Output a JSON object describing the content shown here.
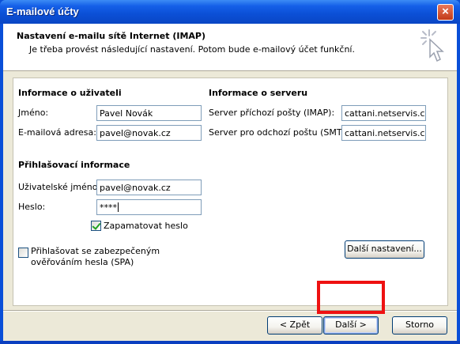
{
  "window": {
    "title": "E-mailové účty",
    "close_label": "×"
  },
  "header": {
    "title": "Nastavení e-mailu sítě Internet (IMAP)",
    "subtitle": "Je třeba provést následující nastavení. Potom bude e-mailový účet funkční.",
    "icon": "wizard-cursor-icon"
  },
  "user_info": {
    "heading": "Informace o uživateli",
    "name_label": "Jméno:",
    "name_value": "Pavel Novák",
    "email_label": "E-mailová adresa:",
    "email_value": "pavel@novak.cz"
  },
  "server_info": {
    "heading": "Informace o serveru",
    "incoming_label": "Server příchozí pošty (IMAP):",
    "incoming_value": "cattani.netservis.cz",
    "outgoing_label": "Server pro odchozí poštu (SMTP):",
    "outgoing_value": "cattani.netservis.cz"
  },
  "login_info": {
    "heading": "Přihlašovací informace",
    "username_label": "Uživatelské jméno:",
    "username_value": "pavel@novak.cz",
    "password_label": "Heslo:",
    "password_value": "****",
    "remember_label": "Zapamatovat heslo",
    "remember_checked": true
  },
  "spa": {
    "label_line1": "Přihlašovat se zabezpečeným",
    "label_line2": "ověřováním hesla (SPA)",
    "checked": false
  },
  "buttons": {
    "more_settings": "Další nastavení...",
    "back": "< Zpět",
    "next": "Další >",
    "cancel": "Storno"
  },
  "colors": {
    "highlight": "#ee1111",
    "titlebar": "#0b4fd6",
    "dialog_bg": "#ece9d8"
  }
}
